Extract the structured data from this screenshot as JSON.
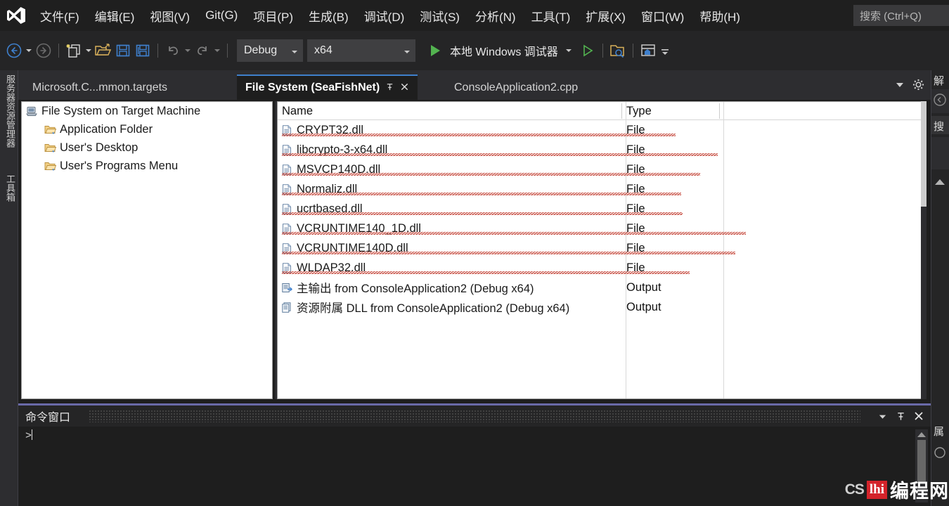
{
  "menubar": {
    "logo_icon": "visual-studio-logo",
    "items": [
      {
        "label": "文件(F)",
        "accel": "F"
      },
      {
        "label": "编辑(E)",
        "accel": "E"
      },
      {
        "label": "视图(V)",
        "accel": "V"
      },
      {
        "label": "Git(G)",
        "accel": "G"
      },
      {
        "label": "项目(P)",
        "accel": "P"
      },
      {
        "label": "生成(B)",
        "accel": "B"
      },
      {
        "label": "调试(D)",
        "accel": "D"
      },
      {
        "label": "测试(S)",
        "accel": "S"
      },
      {
        "label": "分析(N)",
        "accel": "N"
      },
      {
        "label": "工具(T)",
        "accel": "T"
      },
      {
        "label": "扩展(X)",
        "accel": "X"
      },
      {
        "label": "窗口(W)",
        "accel": "W"
      },
      {
        "label": "帮助(H)",
        "accel": "H"
      }
    ],
    "search_placeholder": "搜索 (Ctrl+Q)"
  },
  "toolbar": {
    "back_icon": "navigate-back-icon",
    "forward_icon": "navigate-forward-icon",
    "new_item_icon": "new-item-icon",
    "open_icon": "open-file-icon",
    "save_icon": "save-icon",
    "save_all_icon": "save-all-icon",
    "undo_icon": "undo-icon",
    "redo_icon": "redo-icon",
    "configuration": "Debug",
    "platform": "x64",
    "run_label": "本地 Windows 调试器",
    "run_icon": "play-icon",
    "start_without_debug_icon": "play-outline-icon",
    "search_folder_icon": "folder-search-icon",
    "window_home_icon": "window-home-icon",
    "overflow_icon": "toolbar-overflow-icon"
  },
  "left_sidebar": {
    "items": [
      {
        "label": "服务器资源管理器"
      },
      {
        "label": "工具箱"
      }
    ]
  },
  "tabs": {
    "items": [
      {
        "label": "Microsoft.C...mmon.targets",
        "active": false
      },
      {
        "label": "File System (SeaFishNet)",
        "active": true
      },
      {
        "label": "ConsoleApplication2.cpp",
        "active": false
      }
    ],
    "pin_icon": "pin-icon",
    "close_icon": "close-icon",
    "dropdown_icon": "chevron-down-icon",
    "settings_icon": "gear-icon"
  },
  "tree": {
    "nodes": [
      {
        "label": "File System on Target Machine",
        "icon": "computer-icon",
        "indent": 0
      },
      {
        "label": "Application Folder",
        "icon": "folder-icon",
        "indent": 1
      },
      {
        "label": "User's Desktop",
        "icon": "folder-icon",
        "indent": 1
      },
      {
        "label": "User's Programs Menu",
        "icon": "folder-icon",
        "indent": 1
      }
    ]
  },
  "filelist": {
    "columns": [
      "Name",
      "Type"
    ],
    "rows": [
      {
        "name": "CRYPT32.dll",
        "type": "File",
        "icon": "file-icon",
        "squiggle": true,
        "squiggle_width": 120
      },
      {
        "name": "libcrypto-3-x64.dll",
        "type": "File",
        "icon": "file-icon",
        "squiggle": true,
        "squiggle_width": 180
      },
      {
        "name": "MSVCP140D.dll",
        "type": "File",
        "icon": "file-icon",
        "squiggle": true,
        "squiggle_width": 155
      },
      {
        "name": "Normaliz.dll",
        "type": "File",
        "icon": "file-icon",
        "squiggle": true,
        "squiggle_width": 128
      },
      {
        "name": "ucrtbased.dll",
        "type": "File",
        "icon": "file-icon",
        "squiggle": true,
        "squiggle_width": 130
      },
      {
        "name": "VCRUNTIME140_1D.dll",
        "type": "File",
        "icon": "file-icon",
        "squiggle": true,
        "squiggle_width": 220
      },
      {
        "name": "VCRUNTIME140D.dll",
        "type": "File",
        "icon": "file-icon",
        "squiggle": true,
        "squiggle_width": 205
      },
      {
        "name": "WLDAP32.dll",
        "type": "File",
        "icon": "file-icon",
        "squiggle": true,
        "squiggle_width": 140
      },
      {
        "name": "主输出 from ConsoleApplication2 (Debug x64)",
        "type": "Output",
        "icon": "output-icon",
        "squiggle": false,
        "squiggle_width": 0
      },
      {
        "name": "资源附属 DLL from ConsoleApplication2 (Debug x64)",
        "type": "Output",
        "icon": "satellite-output-icon",
        "squiggle": false,
        "squiggle_width": 0
      }
    ]
  },
  "command_window": {
    "title": "命令窗口",
    "prompt": ">",
    "dropdown_icon": "chevron-down-icon",
    "pin_icon": "pin-icon",
    "close_icon": "close-icon"
  },
  "right_sidebar": {
    "solution_explorer_label": "解",
    "search_label": "搜",
    "properties_label": "属",
    "back_icon": "circle-back-icon"
  },
  "watermark": {
    "prefix": "CS",
    "logo": "lhi",
    "text": "编程网"
  },
  "colors": {
    "chrome_bg": "#1f1f1f",
    "toolbar_bg": "#252526",
    "tabbar_bg": "#2d2d30",
    "accent_blue": "#3f80cd",
    "run_green": "#53b450",
    "cmd_border": "#6a6aa8",
    "squiggle_red": "#c0392b",
    "panel_white": "#ffffff",
    "watermark_red": "#d4232a"
  }
}
